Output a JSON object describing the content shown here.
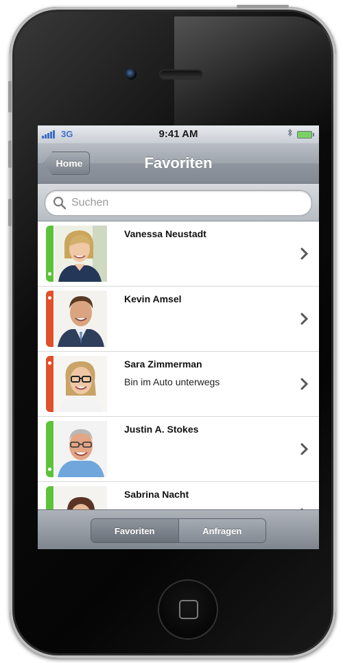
{
  "statusbar": {
    "carrier": "3G",
    "time": "9:41 AM"
  },
  "navbar": {
    "back_label": "Home",
    "title": "Favoriten"
  },
  "search": {
    "placeholder": "Suchen",
    "value": ""
  },
  "contacts": [
    {
      "name": "Vanessa Neustadt",
      "status_message": "",
      "presence": "available",
      "presence_color": "#5cc23a"
    },
    {
      "name": "Kevin Amsel",
      "status_message": "",
      "presence": "busy",
      "presence_color": "#e0502a"
    },
    {
      "name": "Sara Zimmerman",
      "status_message": "Bin im Auto unterwegs",
      "presence": "busy",
      "presence_color": "#e0502a"
    },
    {
      "name": "Justin A. Stokes",
      "status_message": "",
      "presence": "available",
      "presence_color": "#5cc23a"
    },
    {
      "name": "Sabrina Nacht",
      "status_message": "",
      "presence": "available",
      "presence_color": "#5cc23a"
    }
  ],
  "tabs": [
    {
      "label": "Favoriten",
      "active": true
    },
    {
      "label": "Anfragen",
      "active": false
    }
  ]
}
